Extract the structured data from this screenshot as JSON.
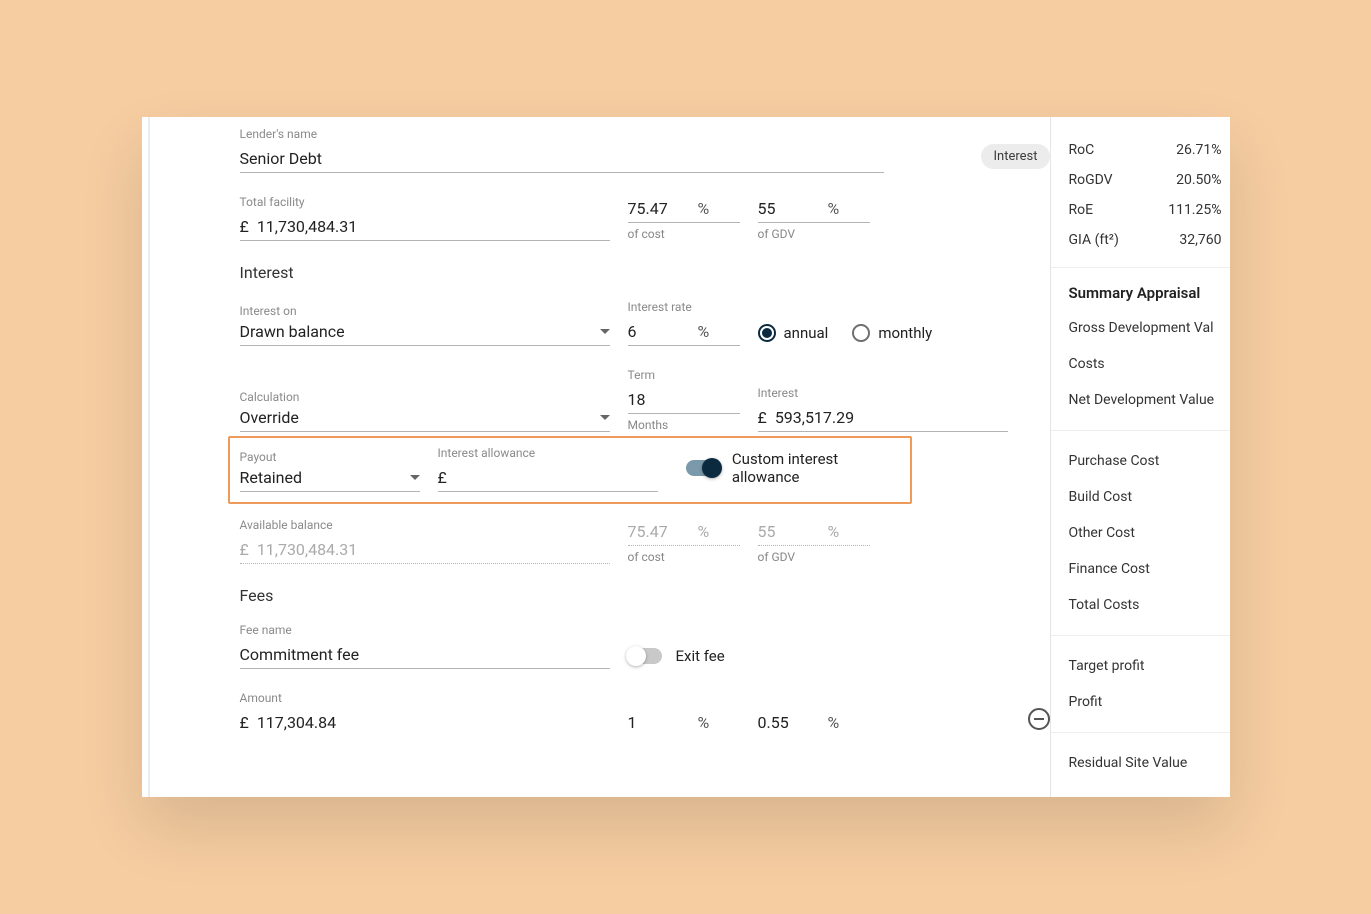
{
  "lender": {
    "name_label": "Lender's name",
    "name": "Senior Debt",
    "badge": "Interest"
  },
  "facility": {
    "label": "Total facility",
    "currency": "£",
    "amount": "11,730,484.31",
    "of_cost": "75.47",
    "of_cost_label": "of cost",
    "of_gdv": "55",
    "of_gdv_label": "of GDV"
  },
  "interest": {
    "heading": "Interest",
    "on_label": "Interest on",
    "on_value": "Drawn balance",
    "rate_label": "Interest rate",
    "rate": "6",
    "period_annual": "annual",
    "period_monthly": "monthly",
    "calc_label": "Calculation",
    "calc_value": "Override",
    "term_label": "Term",
    "term_value": "18",
    "term_unit": "Months",
    "interest_label": "Interest",
    "interest_currency": "£",
    "interest_amount": "593,517.29",
    "payout_label": "Payout",
    "payout_value": "Retained",
    "allowance_label": "Interest allowance",
    "allowance_currency": "£",
    "allowance_value": "",
    "custom_toggle_label": "Custom interest allowance"
  },
  "available": {
    "label": "Available balance",
    "currency": "£",
    "amount": "11,730,484.31",
    "of_cost": "75.47",
    "of_cost_label": "of cost",
    "of_gdv": "55",
    "of_gdv_label": "of GDV"
  },
  "fees": {
    "heading": "Fees",
    "name_label": "Fee name",
    "name_value": "Commitment fee",
    "exit_label": "Exit fee",
    "amount_label": "Amount",
    "amount_currency": "£",
    "amount_value": "117,304.84",
    "pct1": "1",
    "pct2": "0.55"
  },
  "summary": {
    "metrics": [
      {
        "k": "RoC",
        "v": "26.71%"
      },
      {
        "k": "RoGDV",
        "v": "20.50%"
      },
      {
        "k": "RoE",
        "v": "111.25%"
      },
      {
        "k": "GIA (ft²)",
        "v": "32,760"
      }
    ],
    "appraisal_title": "Summary Appraisal",
    "appraisal_items": [
      "Gross Development Val",
      "Costs",
      "Net Development Value"
    ],
    "cost_items": [
      "Purchase Cost",
      "Build Cost",
      "Other Cost",
      "Finance Cost",
      "Total Costs"
    ],
    "profit_items": [
      "Target profit",
      "Profit"
    ],
    "residual": "Residual Site Value"
  },
  "pct_symbol": "%"
}
